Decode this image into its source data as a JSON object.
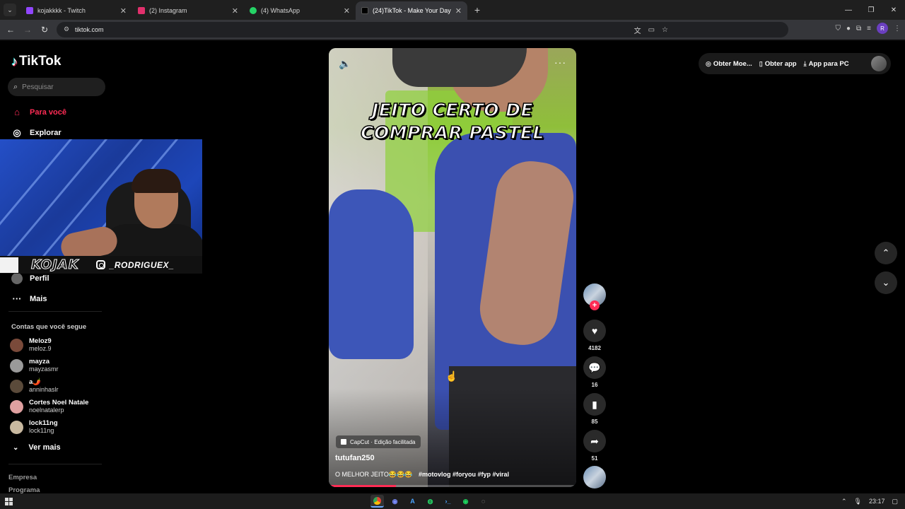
{
  "browser": {
    "tabs": [
      {
        "title": "kojakkkk - Twitch",
        "color": "#9146ff"
      },
      {
        "title": "(2) Instagram",
        "color": "#e1306c"
      },
      {
        "title": "(4) WhatsApp",
        "color": "#25d366"
      },
      {
        "title": "(24)TikTok - Make Your Day",
        "color": "#000000"
      }
    ],
    "url": "tiktok.com"
  },
  "sidebar": {
    "logo": "TikTok",
    "search_placeholder": "Pesquisar",
    "nav": {
      "for_you": "Para você",
      "explore": "Explorar",
      "profile": "Perfil",
      "more": "Mais"
    },
    "following_title": "Contas que você segue",
    "following": [
      {
        "name": "Meloz9",
        "user": "meloz.9",
        "color": "#7a4a3a"
      },
      {
        "name": "mayza",
        "user": "mayzasmr",
        "color": "#9a9a9a"
      },
      {
        "name": "a🌶️",
        "user": "anninhaslr",
        "color": "#5a4a3a"
      },
      {
        "name": "Cortes Noel Natale",
        "user": "noelnatalerp",
        "color": "#e0a0a0"
      },
      {
        "name": "lock11ng",
        "user": "lock11ng",
        "color": "#c9b9a0"
      }
    ],
    "see_more": "Ver mais",
    "footer": [
      "Empresa",
      "Programa"
    ]
  },
  "webcam": {
    "tag": "KOJAK",
    "instagram": "_RODRIGUEX_"
  },
  "video": {
    "overlay_title": "JEITO CERTO DE COMPRAR PASTEL",
    "badge": "CapCut · Edição facilitada",
    "author": "tutufan250",
    "caption_text": "O MELHOR JEITO😂😂😂",
    "hashtags": "#motovlog #foryou #fyp #viral",
    "progress": 0.27
  },
  "actions": {
    "likes": "4182",
    "comments": "16",
    "saves": "85",
    "shares": "51"
  },
  "topbar": {
    "coins": "Obter Moe...",
    "app": "Obter app",
    "pc": "App para PC"
  },
  "taskbar": {
    "time": "23:17"
  }
}
